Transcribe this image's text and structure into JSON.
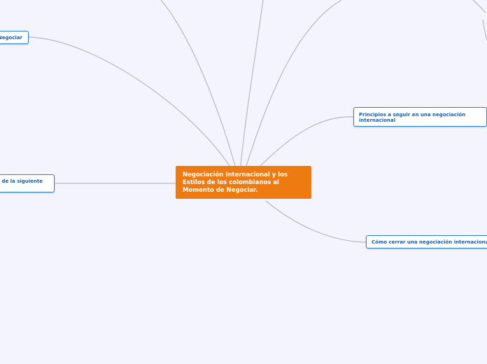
{
  "central": {
    "text": "Negociación Internacional  y los\nEstilos de los colombianos al\nMomento de Negociar."
  },
  "nodes": [
    {
      "text": "Negociar"
    },
    {
      "text": "de la siguiente"
    },
    {
      "text": "Principios a seguir en una negociación\ninternacional"
    },
    {
      "text": "Cómo cerrar una negociación internacional"
    }
  ],
  "colors": {
    "background": "#f4f5fc",
    "central_fill": "#ee7a12",
    "node_border": "#2f7fd0",
    "node_text": "#1a5fa8",
    "connector": "#b4b8c6"
  }
}
